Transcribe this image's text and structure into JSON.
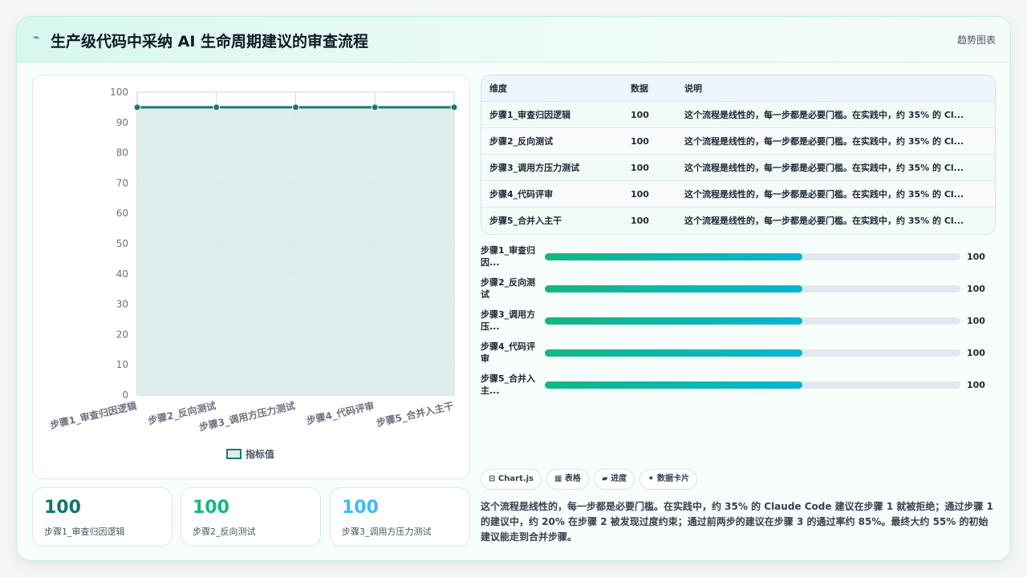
{
  "header": {
    "icon": "lightning-icon",
    "title": "生产级代码中采纳 AI 生命周期建议的审查流程",
    "tag": "趋势图表"
  },
  "chart_data": {
    "type": "line",
    "categories": [
      "步骤1_审查归因逻辑",
      "步骤2_反向测试",
      "步骤3_调用方压力测试",
      "步骤4_代码评审",
      "步骤5_合并入主干"
    ],
    "series": [
      {
        "name": "指标值",
        "values": [
          95,
          95,
          95,
          95,
          95
        ]
      }
    ],
    "ylim": [
      0,
      100
    ],
    "yticks": [
      0,
      10,
      20,
      30,
      40,
      50,
      60,
      70,
      80,
      90,
      100
    ],
    "grid": true,
    "legend": "bottom",
    "colors": {
      "line": "#1a7a70",
      "area": "#dcecea",
      "grid": "#c9d9e6"
    }
  },
  "stats": [
    {
      "value": "100",
      "label": "步骤1_审查归因逻辑",
      "color": "#0f766e"
    },
    {
      "value": "100",
      "label": "步骤2_反向测试",
      "color": "#10b981"
    },
    {
      "value": "100",
      "label": "步骤3_调用方压力测试",
      "color": "#38bdf8"
    }
  ],
  "table": {
    "headers": [
      "维度",
      "数据",
      "说明"
    ],
    "rows": [
      [
        "步骤1_审查归因逻辑",
        "100",
        "这个流程是线性的，每一步都是必要门槛。在实践中，约 35% 的 Cl..."
      ],
      [
        "步骤2_反向测试",
        "100",
        "这个流程是线性的，每一步都是必要门槛。在实践中，约 35% 的 Cl..."
      ],
      [
        "步骤3_调用方压力测试",
        "100",
        "这个流程是线性的，每一步都是必要门槛。在实践中，约 35% 的 Cl..."
      ],
      [
        "步骤4_代码评审",
        "100",
        "这个流程是线性的，每一步都是必要门槛。在实践中，约 35% 的 Cl..."
      ],
      [
        "步骤5_合并入主干",
        "100",
        "这个流程是线性的，每一步都是必要门槛。在实践中，约 35% 的 Cl..."
      ]
    ]
  },
  "progress": [
    {
      "label": "步骤1_审查归因...",
      "value": "100",
      "fill": 0.62
    },
    {
      "label": "步骤2_反向测试",
      "value": "100",
      "fill": 0.62
    },
    {
      "label": "步骤3_调用方压...",
      "value": "100",
      "fill": 0.62
    },
    {
      "label": "步骤4_代码评审",
      "value": "100",
      "fill": 0.62
    },
    {
      "label": "步骤5_合并入主...",
      "value": "100",
      "fill": 0.62
    }
  ],
  "chips": [
    "⊟ Chart.js",
    "▦ 表格",
    "▰ 进度",
    "✦ 数据卡片"
  ],
  "description": "这个流程是线性的，每一步都是必要门槛。在实践中，约 35% 的 Claude Code 建议在步骤 1 就被拒绝；通过步骤 1 的建议中，约 20% 在步骤 2 被发现过度约束；通过前两步的建议在步骤 3 的通过率约 85%。最终大约 55% 的初始建议能走到合并步骤。"
}
